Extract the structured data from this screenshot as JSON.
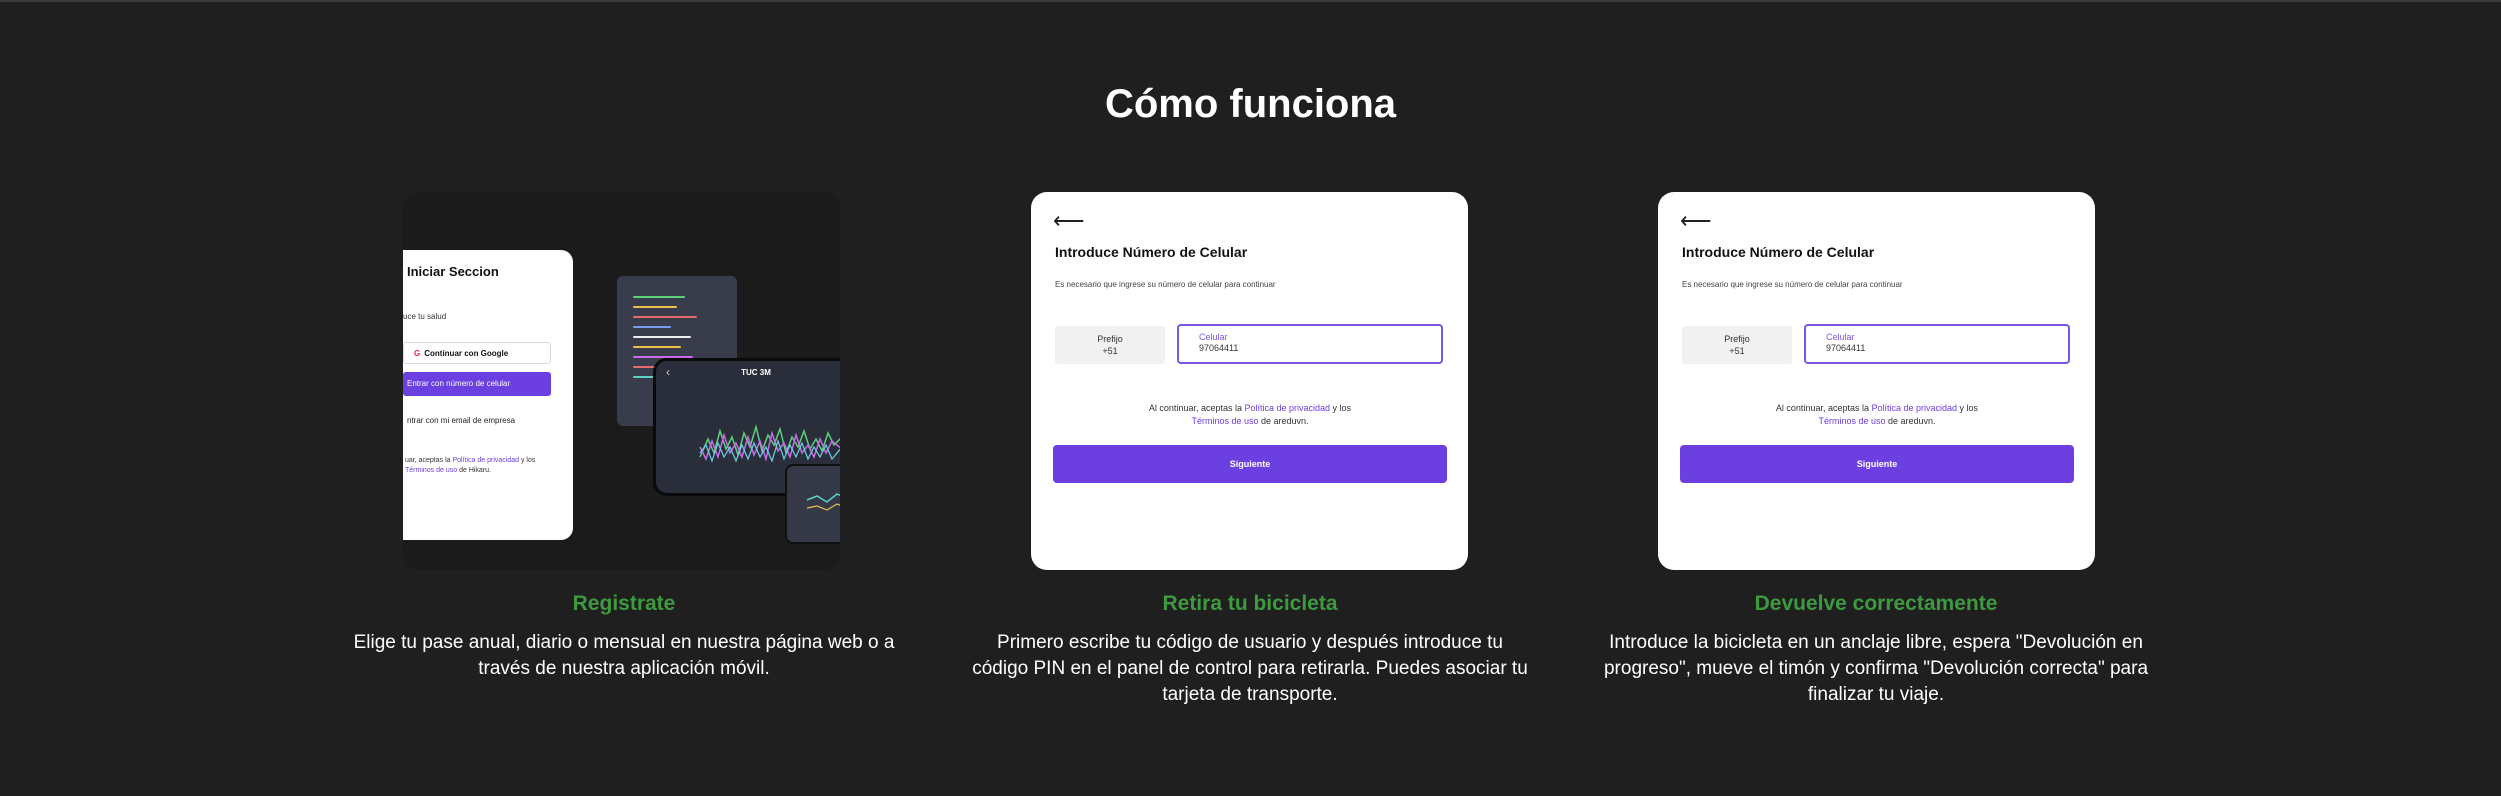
{
  "section": {
    "title": "Cómo funciona"
  },
  "steps": [
    {
      "title": "Registrate",
      "description": "Elige tu pase anual, diario o mensual en nuestra página web o a través de nuestra aplicación móvil.",
      "mock": {
        "login_title": "Iniciar Seccion",
        "login_sub": "uce tu salud",
        "google_button": "Continuar con Google",
        "phone_button": "Entrar con número de celular",
        "email_link": "ntrar con mi email de empresa",
        "terms_prefix": "uar, aceptas la ",
        "terms_policy": "Política de privacidad",
        "terms_mid": " y los",
        "terms_link": "Términos de uso",
        "terms_suffix": " de Hikaru.",
        "phone_header": "TUC 3M",
        "back_icon": "chevron-left-icon"
      }
    },
    {
      "title": "Retira tu bicicleta",
      "description": "Primero escribe tu código de usuario y después introduce tu código PIN en el panel de control para retirarla. Puedes asociar tu tarjeta de transporte.",
      "mock": {
        "back_icon": "arrow-left-icon",
        "back_arrow": "⟵",
        "title": "Introduce Número de Celular",
        "subtitle": "Es necesario que ingrese su número de celular para continuar",
        "prefix_label": "Prefijo",
        "prefix_value": "+51",
        "phone_label": "Celular",
        "phone_value": "97064411",
        "terms_prefix": "Al continuar, aceptas la ",
        "terms_policy": "Política de privacidad",
        "terms_mid": " y los",
        "terms_link": "Términos de uso",
        "terms_suffix": " de areduvn.",
        "button": "Siguiente"
      }
    },
    {
      "title": "Devuelve correctamente",
      "description": "Introduce la bicicleta en un anclaje libre, espera \"Devolución en progreso\", mueve el timón y confirma \"Devolución correcta\" para finalizar tu viaje.",
      "mock": {
        "back_icon": "arrow-left-icon",
        "back_arrow": "⟵",
        "title": "Introduce Número de Celular",
        "subtitle": "Es necesario que ingrese su número de celular para continuar",
        "prefix_label": "Prefijo",
        "prefix_value": "+51",
        "phone_label": "Celular",
        "phone_value": "97064411",
        "terms_prefix": "Al continuar, aceptas la ",
        "terms_policy": "Política de privacidad",
        "terms_mid": " y los",
        "terms_link": "Términos de uso",
        "terms_suffix": " de areduvn.",
        "button": "Siguiente"
      }
    }
  ],
  "colors": {
    "background": "#1f1f1f",
    "step_title": "#3e9a3e",
    "accent": "#6b3fe0"
  }
}
